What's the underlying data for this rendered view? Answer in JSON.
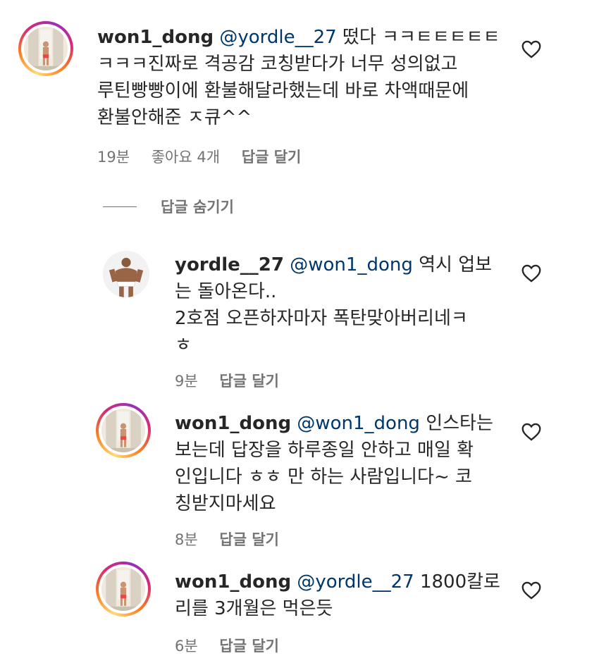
{
  "comments": [
    {
      "username": "won1_dong",
      "mention": "@yordle__27",
      "lines": [
        "떴다 ㅋㅋㅌㅌㅌㅌㅌ",
        "ㅋㅋㅋ진짜로 격공감 코칭받다가 너무 성의없고",
        "루틴빵빵이에 환불해달라했는데 바로 차액때문에",
        "환불안해준 ㅈ큐^^"
      ],
      "time": "19분",
      "likes": "좋아요 4개",
      "reply": "답글 달기"
    },
    {
      "username": "yordle__27",
      "mention": "@won1_dong",
      "lines": [
        "역시 업보",
        "는 돌아온다..",
        "2호점 오픈하자마자 폭탄맞아버리네ㅋ",
        "ㅎ"
      ],
      "time": "9분",
      "reply": "답글 달기"
    },
    {
      "username": "won1_dong",
      "mention": "@won1_dong",
      "lines": [
        "인스타는",
        "보는데 답장을 하루종일 안하고 매일 확",
        "인입니다 ㅎㅎ 만 하는 사람입니다~ 코",
        "칭받지마세요"
      ],
      "time": "8분",
      "reply": "답글 달기"
    },
    {
      "username": "won1_dong",
      "mention": "@yordle__27",
      "lines": [
        "1800칼로",
        "리를 3개월은 먹은듯"
      ],
      "time": "6분",
      "reply": "답글 달기"
    }
  ],
  "hide_replies_label": "답글 숨기기",
  "icons": {
    "like": "heart-outline-icon",
    "avatar_story_ring": "story-ring"
  },
  "colors": {
    "text": "#262626",
    "mention": "#00376b",
    "meta": "#737373"
  }
}
